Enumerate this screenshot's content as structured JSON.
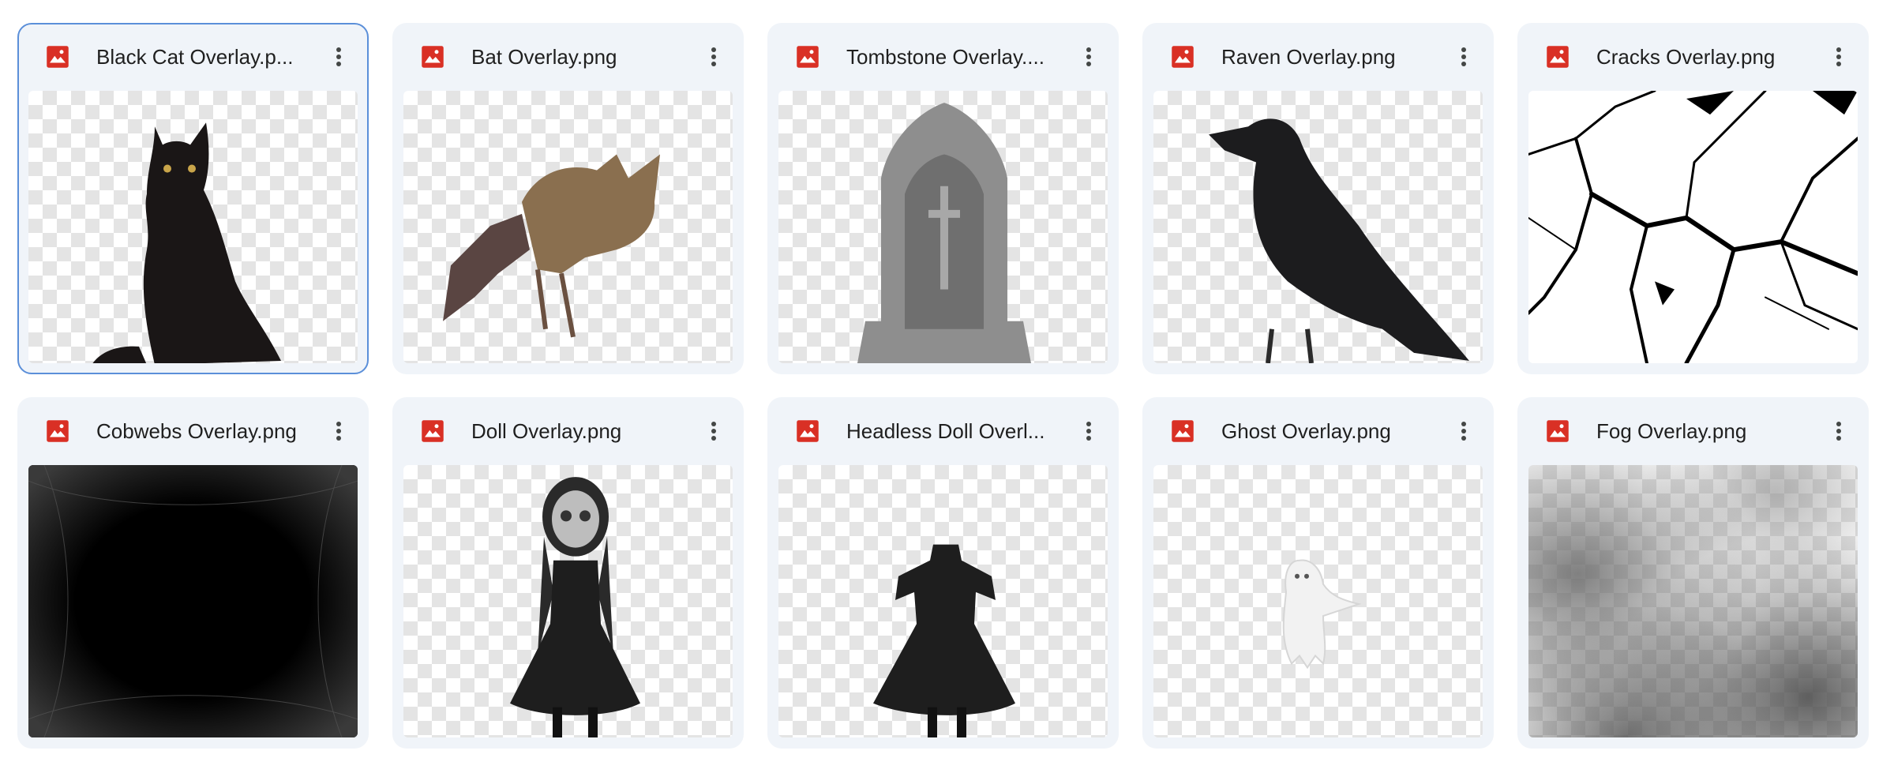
{
  "colors": {
    "card_bg": "#f0f4f9",
    "selected_border": "#5b8fd9",
    "image_icon": "#d93025",
    "text": "#1f1f1f"
  },
  "files": [
    {
      "name": "Black Cat Overlay.png",
      "display_name": "Black Cat Overlay.p...",
      "icon": "image-file-icon",
      "selected": true
    },
    {
      "name": "Bat Overlay.png",
      "display_name": "Bat Overlay.png",
      "icon": "image-file-icon"
    },
    {
      "name": "Tombstone Overlay.png",
      "display_name": "Tombstone Overlay....",
      "icon": "image-file-icon"
    },
    {
      "name": "Raven Overlay.png",
      "display_name": "Raven Overlay.png",
      "icon": "image-file-icon"
    },
    {
      "name": "Cracks Overlay.png",
      "display_name": "Cracks Overlay.png",
      "icon": "image-file-icon"
    },
    {
      "name": "Cobwebs Overlay.png",
      "display_name": "Cobwebs Overlay.png",
      "icon": "image-file-icon"
    },
    {
      "name": "Doll Overlay.png",
      "display_name": "Doll Overlay.png",
      "icon": "image-file-icon"
    },
    {
      "name": "Headless Doll Overlay.png",
      "display_name": "Headless Doll Overl...",
      "icon": "image-file-icon"
    },
    {
      "name": "Ghost Overlay.png",
      "display_name": "Ghost Overlay.png",
      "icon": "image-file-icon"
    },
    {
      "name": "Fog Overlay.png",
      "display_name": "Fog Overlay.png",
      "icon": "image-file-icon"
    }
  ]
}
